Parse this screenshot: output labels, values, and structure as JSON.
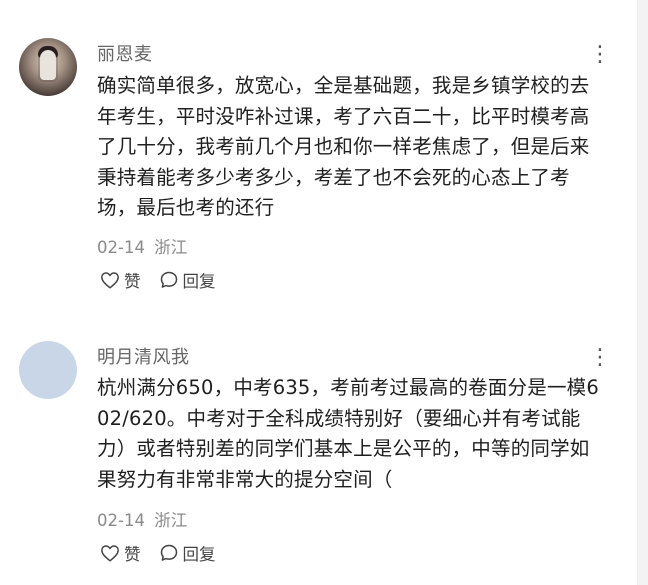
{
  "comments": [
    {
      "username": "丽恩麦",
      "text": "确实简单很多，放宽心，全是基础题，我是乡镇学校的去年考生，平时没咋补过课，考了六百二十，比平时模考高了几十分，我考前几个月也和你一样老焦虑了，但是后来秉持着能考多少考多少，考差了也不会死的心态上了考场，最后也考的还行",
      "date": "02-14",
      "location": "浙江",
      "like_label": "赞",
      "reply_label": "回复",
      "more_label": "⋮"
    },
    {
      "username": "明月清风我",
      "text": "杭州满分650，中考635，考前考过最高的卷面分是一模602/620。中考对于全科成绩特别好（要细心并有考试能力）或者特别差的同学们基本上是公平的，中等的同学如果努力有非常非常大的提分空间（",
      "date": "02-14",
      "location": "浙江",
      "like_label": "赞",
      "reply_label": "回复",
      "more_label": "⋮"
    }
  ],
  "icons": {
    "like": "heart-outline-icon",
    "reply": "speech-bubble-icon",
    "more": "vertical-dots-icon"
  },
  "colors": {
    "username": "#666666",
    "meta": "#8a8a8a",
    "text": "#1f1f1f",
    "second_avatar": "#c8d6e8"
  }
}
